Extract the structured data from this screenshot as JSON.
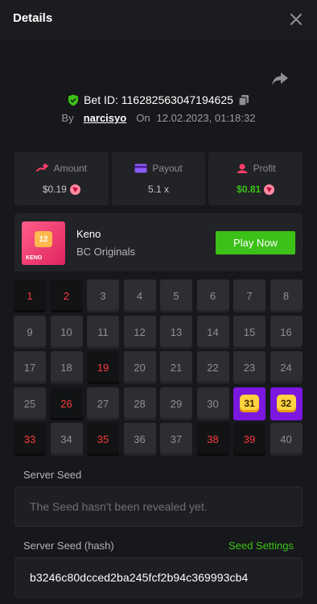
{
  "header": {
    "title": "Details",
    "close_icon": "close-icon"
  },
  "bet": {
    "id_label": "Bet ID: 116282563047194625",
    "by_label": "By",
    "user": "narcisyo",
    "on_label": "On",
    "datetime": "12.02.2023, 01:18:32"
  },
  "stats": [
    {
      "label": "Amount",
      "value": "$0.19",
      "icon": "amount-icon",
      "has_coin": true,
      "value_color": "#c4c5c9"
    },
    {
      "label": "Payout",
      "value": "5.1 x",
      "icon": "payout-icon",
      "has_coin": false,
      "value_color": "#c4c5c9"
    },
    {
      "label": "Profit",
      "value": "$0.81",
      "icon": "profit-icon",
      "has_coin": true,
      "value_color": "#3bc117"
    }
  ],
  "game": {
    "name": "Keno",
    "provider": "BC Originals",
    "play_label": "Play Now",
    "thumb_number": "12",
    "thumb_name": "KENO"
  },
  "board": {
    "picked": [
      1,
      2,
      19,
      26,
      33,
      35,
      38,
      39
    ],
    "hits": [
      31,
      32
    ],
    "numbers": [
      1,
      2,
      3,
      4,
      5,
      6,
      7,
      8,
      9,
      10,
      11,
      12,
      13,
      14,
      15,
      16,
      17,
      18,
      19,
      20,
      21,
      22,
      23,
      24,
      25,
      26,
      27,
      28,
      29,
      30,
      31,
      32,
      33,
      34,
      35,
      36,
      37,
      38,
      39,
      40
    ]
  },
  "seeds": {
    "server_seed_label": "Server Seed",
    "server_seed_placeholder": "The Seed hasn't been revealed yet.",
    "server_hash_label": "Server Seed (hash)",
    "seed_settings_label": "Seed Settings",
    "server_hash_value": "b3246c80dcced2ba245fcf2b94c369993cb4"
  },
  "colors": {
    "accent_green": "#3bc117",
    "picked_red": "#ff3b3b",
    "hit_purple": "#7c17e0",
    "hit_yellow": "#ffd23f"
  }
}
